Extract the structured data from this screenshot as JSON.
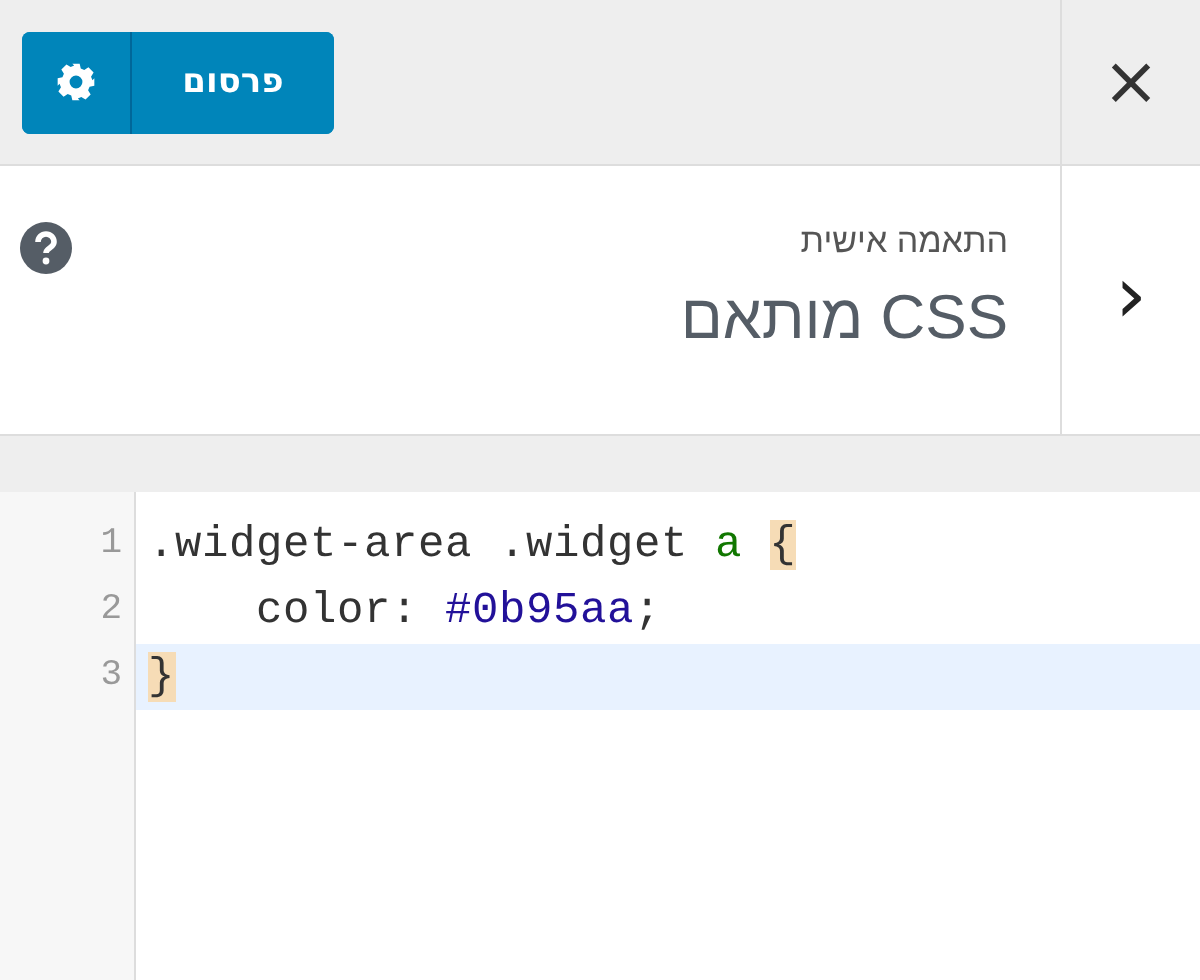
{
  "header": {
    "close_label": "×",
    "publish_button": "פרסום"
  },
  "section": {
    "subtitle": "התאמה אישית",
    "title": "CSS מותאם",
    "back_label": "›"
  },
  "editor": {
    "lines": [
      {
        "number": "1",
        "active": false,
        "kind": "rule_open",
        "selector": ".widget-area .widget",
        "element": "a",
        "brace": "{",
        "brace_matched": true
      },
      {
        "number": "2",
        "active": false,
        "kind": "declaration",
        "property": "color:",
        "value": "#0b95aa",
        "end": ";"
      },
      {
        "number": "3",
        "active": true,
        "kind": "rule_close",
        "brace": "}",
        "brace_matched": true
      }
    ]
  }
}
